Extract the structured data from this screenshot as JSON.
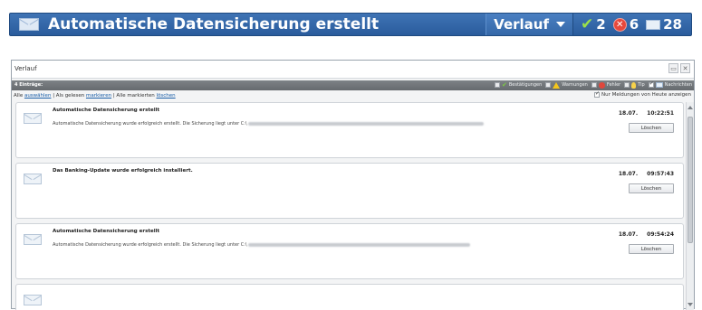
{
  "notification": {
    "title": "Automatische Datensicherung erstellt",
    "history_button": "Verlauf",
    "confirmations_count": "2",
    "errors_count": "6",
    "messages_count": "28",
    "icons": {
      "message": "envelope-icon",
      "confirm": "checkmark-icon",
      "error": "error-x-icon"
    }
  },
  "window": {
    "title": "Verlauf",
    "entries_label": "4 Einträge:",
    "filters": [
      {
        "label": "Bestätigungen",
        "icon": "checkmark-icon"
      },
      {
        "label": "Warnungen",
        "icon": "warning-icon"
      },
      {
        "label": "Fehler",
        "icon": "error-icon"
      },
      {
        "label": "Tip",
        "icon": "lightbulb-icon"
      },
      {
        "label": "Nachrichten",
        "icon": "envelope-icon"
      }
    ],
    "actions": {
      "prefix_all": "Alle",
      "select_link": "auswählen",
      "mark_read_text": "| Als gelesen",
      "mark_link": "markieren",
      "delete_all_text": "| Alle markierten",
      "delete_link": "löschen"
    },
    "today_only_label": "Nur Meldungen von Heute anzeigen",
    "messages": [
      {
        "title": "Automatische Datensicherung erstellt",
        "body": "Automatische Datensicherung wurde erfolgreich erstellt. Die Sicherung liegt unter C:\\",
        "date": "18.07.",
        "time": "10:22:51",
        "delete_label": "Löschen"
      },
      {
        "title": "Das Banking-Update wurde erfolgreich installiert.",
        "body": "",
        "date": "18.07.",
        "time": "09:57:43",
        "delete_label": "Löschen"
      },
      {
        "title": "Automatische Datensicherung erstellt",
        "body": "Automatische Datensicherung wurde erfolgreich erstellt. Die Sicherung liegt unter C:\\",
        "date": "18.07.",
        "time": "09:54:24",
        "delete_label": "Löschen"
      }
    ]
  }
}
